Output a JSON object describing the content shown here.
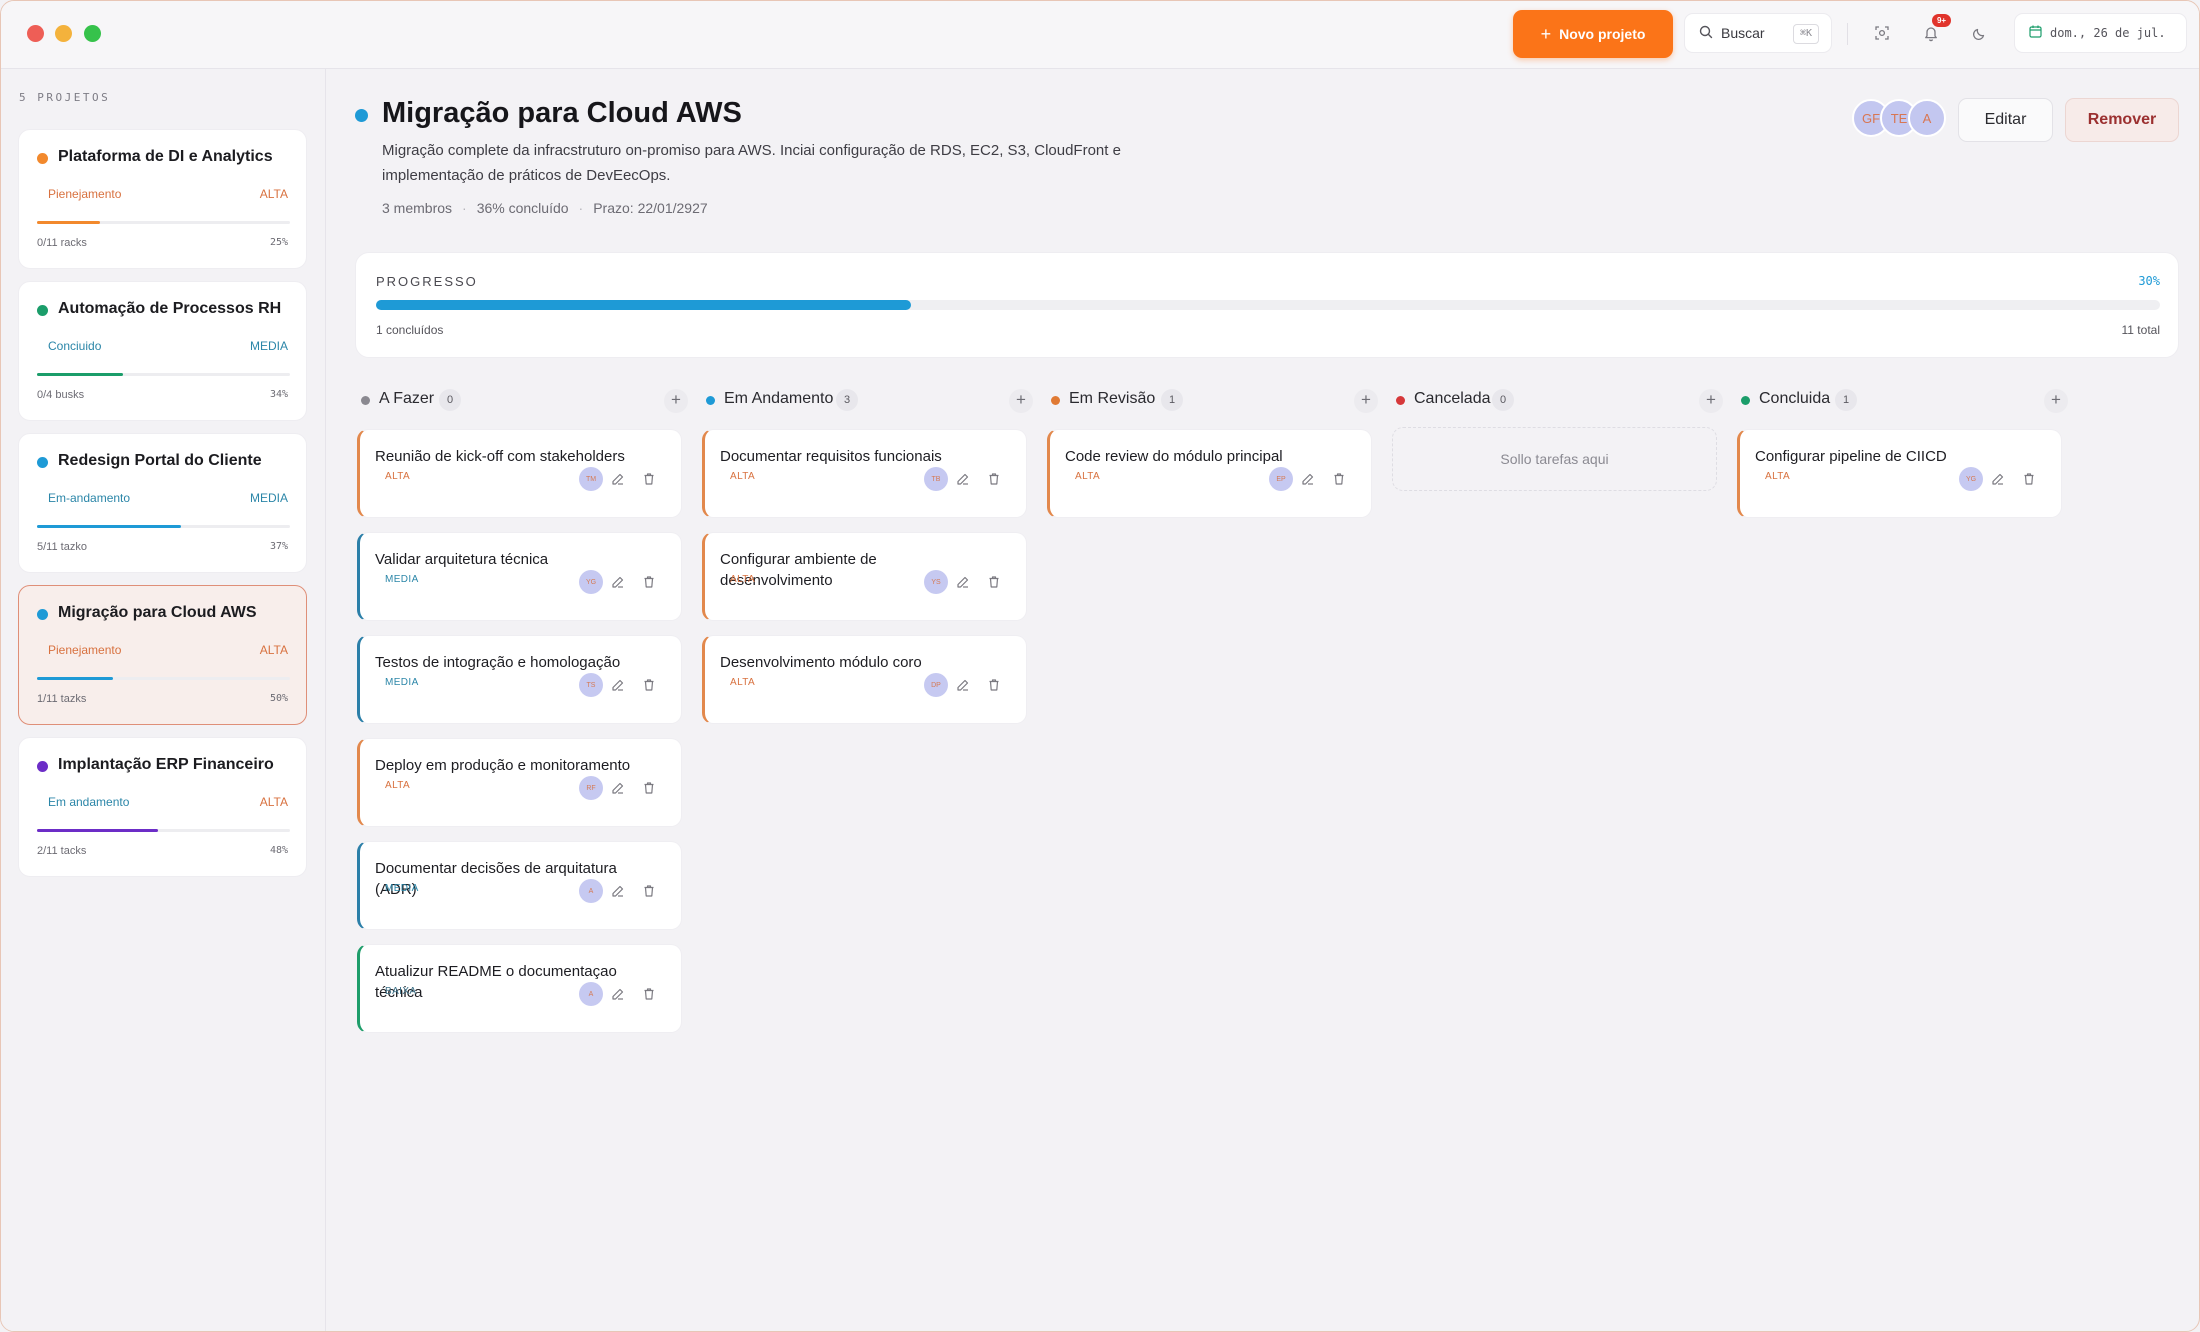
{
  "titlebar": {
    "new_project_label": "Novo projeto",
    "search_label": "Buscar",
    "search_shortcut": "⌘K",
    "notification_count": "9+",
    "date_label": "dom., 26 de jul."
  },
  "sidebar": {
    "heading": "5 PROJETOS",
    "projects": [
      {
        "title": "Plataforma de DI e Analytics",
        "status": "Pienejamento",
        "priority": "ALTA",
        "tasks": "0/11 racks",
        "percent": "25%",
        "dot_color": "#f2892d",
        "status_color": "#d8713f",
        "priority_color": "#d8713f",
        "progress": 0.25,
        "bar_color": "#f2892d"
      },
      {
        "title": "Automação de Processos RH",
        "status": "Conciuido",
        "priority": "MEDIA",
        "tasks": "0/4 busks",
        "percent": "34%",
        "dot_color": "#1b9d6a",
        "status_color": "#2b86a8",
        "priority_color": "#2b86a8",
        "progress": 0.34,
        "bar_color": "#1b9d6a"
      },
      {
        "title": "Redesign Portal do Cliente",
        "status": "Em-andamento",
        "priority": "MEDIA",
        "tasks": "5/11 tazko",
        "percent": "37%",
        "dot_color": "#1e9ad6",
        "status_color": "#2b86a8",
        "priority_color": "#2b86a8",
        "progress": 0.57,
        "bar_color": "#1e9ad6"
      },
      {
        "title": "Migração para Cloud AWS",
        "status": "Pienejamento",
        "priority": "ALTA",
        "tasks": "1/11 tazks",
        "percent": "50%",
        "dot_color": "#1e9ad6",
        "status_color": "#d8713f",
        "priority_color": "#d8713f",
        "progress": 0.3,
        "bar_color": "#1e9ad6"
      },
      {
        "title": "Implantação ERP Financeiro",
        "status": "Em andamento",
        "priority": "ALTA",
        "tasks": "2/11 tacks",
        "percent": "48%",
        "dot_color": "#6c2dc7",
        "status_color": "#2b86a8",
        "priority_color": "#d8713f",
        "progress": 0.48,
        "bar_color": "#6c2dc7"
      }
    ]
  },
  "project": {
    "title": "Migração para Cloud AWS",
    "description": "Migração complete da infracstruturo on-promiso para AWS. Inciai configuração de RDS, EC2, S3, CloudFront e implementação de práticos de DevEecOps.",
    "members": "3 membros",
    "completion": "36% concluído",
    "deadline": "Prazo: 22/01/2927",
    "avatars": [
      "GF",
      "TE",
      "A"
    ],
    "edit_label": "Editar",
    "remove_label": "Remover"
  },
  "progress": {
    "label": "PROGRESSO",
    "percent_label": "30%",
    "value": 0.3,
    "completed_label": "1 concluídos",
    "total_label": "11 total"
  },
  "columns": [
    {
      "name": "A Fazer",
      "count": "0",
      "dot_color": "#8a8990",
      "tasks": [
        {
          "title": "Reunião de kick-off com stakeholders",
          "priority": "ALTA",
          "avatar": "TM"
        },
        {
          "title": "Validar arquitetura técnica",
          "priority": "MEDIA",
          "avatar": "YG"
        },
        {
          "title": "Testos de intogração e homologação",
          "priority": "MEDIA",
          "avatar": "TS"
        },
        {
          "title": "Deploy em produção e monitoramento",
          "priority": "ALTA",
          "avatar": "RF"
        },
        {
          "title": "Documentar decisões de arquitatura (ADR)",
          "priority": "MEDIA",
          "avatar": "A"
        },
        {
          "title": "Atualizur README o documentaçao técnica",
          "priority": "BAIXA",
          "avatar": "A"
        }
      ]
    },
    {
      "name": "Em Andamento",
      "count": "3",
      "dot_color": "#1e9ad6",
      "tasks": [
        {
          "title": "Documentar requisitos funcionais",
          "priority": "ALTA",
          "avatar": "TB"
        },
        {
          "title": "Configurar ambiente de desenvolvimento",
          "priority": "ALTA",
          "avatar": "YS"
        },
        {
          "title": "Desenvolvimento módulo coro",
          "priority": "ALTA",
          "avatar": "DP"
        }
      ]
    },
    {
      "name": "Em Revisão",
      "count": "1",
      "dot_color": "#e07a34",
      "tasks": [
        {
          "title": "Code review do módulo principal",
          "priority": "ALTA",
          "avatar": "EP"
        }
      ]
    },
    {
      "name": "Cancelada",
      "count": "0",
      "dot_color": "#d6383a",
      "empty_text": "Sollo tarefas aqui",
      "tasks": []
    },
    {
      "name": "Concluida",
      "count": "1",
      "dot_color": "#1b9d6a",
      "tasks": [
        {
          "title": "Configurar pipeline de CIICD",
          "priority": "ALTA",
          "avatar": "YG"
        }
      ]
    }
  ],
  "colors": {
    "accent_orange": "#fb7418",
    "accent_blue": "#1e9ad6",
    "priority_alta": "#d8713f",
    "priority_media": "#2b86a8",
    "priority_baixa": "#3b6f86",
    "border_alta": "#e2884c",
    "border_media": "#2b7fa8",
    "border_baixa": "#1e9d6a"
  }
}
